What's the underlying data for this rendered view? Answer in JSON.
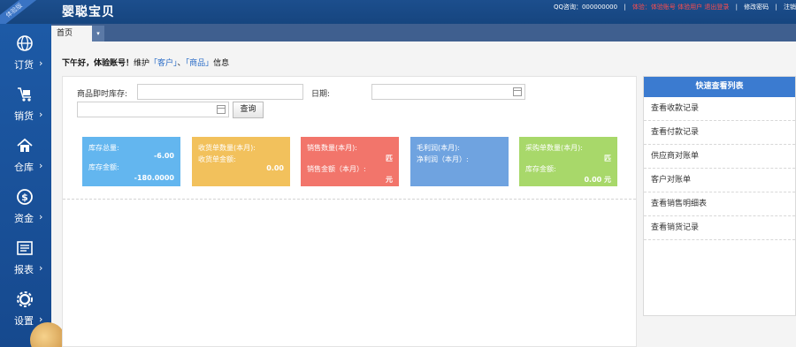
{
  "header": {
    "logo": "婴聪宝贝",
    "ribbon": "体验版",
    "qq": "QQ咨询：000000000",
    "links": [
      "体验：体验账号 体验用户 退出登录",
      "修改密码",
      "注销"
    ]
  },
  "sidebar": {
    "items": [
      {
        "label": "订货",
        "icon": "globe-icon"
      },
      {
        "label": "销货",
        "icon": "cart-icon"
      },
      {
        "label": "仓库",
        "icon": "home-icon"
      },
      {
        "label": "资金",
        "icon": "dollar-icon"
      },
      {
        "label": "报表",
        "icon": "report-icon"
      },
      {
        "label": "设置",
        "icon": "gear-icon"
      }
    ],
    "arrow": "›"
  },
  "tabs": {
    "home": "首页",
    "dropdown": "▾"
  },
  "greeting": {
    "prefix": "下午好，体验账号！",
    "mid": "维护",
    "customer": "「客户」",
    "sep": "、",
    "product": "「商品」",
    "suffix": "信息"
  },
  "search": {
    "label": "商品即时库存:",
    "date_label": "日期:",
    "button": "查询"
  },
  "cards": [
    {
      "l1": "库存总量:",
      "v1": "-6.00",
      "l2": "库存金额:",
      "v2": "-180.0000"
    },
    {
      "l1": "收货单数量(本月):",
      "v1": "",
      "l2": "收货单金额:",
      "v2": "0.00"
    },
    {
      "l1": "销售数量(本月):",
      "v1": "匹",
      "l2": "销售金额（本月）:",
      "v2": "元"
    },
    {
      "l1": "毛利润(本月):",
      "v1": "",
      "l2": "净利润（本月）:",
      "v2": ""
    },
    {
      "l1": "采购单数量(本月):",
      "v1": "匹",
      "l2": "库存金额:",
      "v2": "0.00 元"
    }
  ],
  "quick": {
    "title": "快速查看列表",
    "items": [
      "查看收款记录",
      "查看付款记录",
      "供应商对账单",
      "客户对账单",
      "查看销售明细表",
      "查看销货记录"
    ]
  },
  "colors": {
    "header": "#1c4e8d",
    "sidebar": "#1d5aa6",
    "accent": "#3b7bd0"
  }
}
